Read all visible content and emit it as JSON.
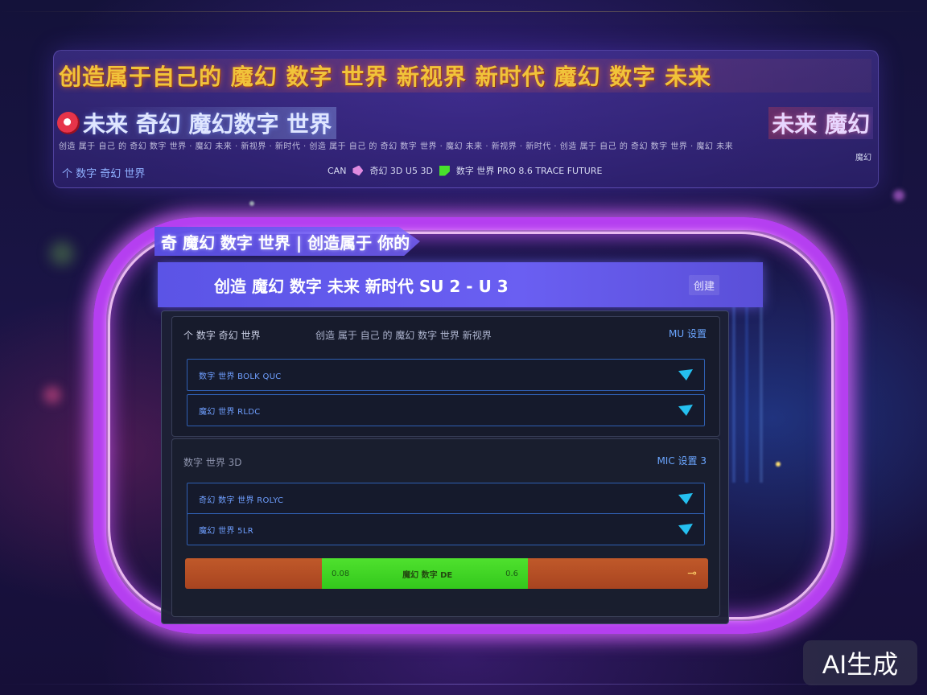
{
  "header": {
    "title": "创造属于自己的 魔幻 数字 世界 新视界 新时代 魔幻 数字 未来",
    "banner_left": "未来 奇幻 魔幻数字 世界",
    "banner_right": "未来 魔幻",
    "fine_print": "创造 属于 自己 的 奇幻 数字 世界 · 魔幻 未来 · 新视界 · 新时代 · 创造 属于 自己 的 奇幻 数字 世界 · 魔幻 未来 · 新视界 · 新时代 · 创造 属于 自己 的 奇幻 数字 世界 · 魔幻 未来",
    "subtitle": "个 数字 奇幻 世界",
    "status_prefix": "CAN",
    "status_a": "奇幻 3D U5 3D",
    "status_b": "数字 世界 PRO 8.6 TRACE FUTURE",
    "corner_glyph": "魔幻"
  },
  "window": {
    "strip_title": "奇 魔幻 数字 世界 | 创造属于 你的",
    "title": "创造 魔幻 数字 未来 新时代 SU 2 - U 3",
    "title_action": "创建"
  },
  "section1": {
    "label": "个 数字 奇幻 世界",
    "note": "创造 属于 自己 的 魔幻 数字 世界 新视界",
    "link": "MU 设置",
    "select_1": "数字 世界 BOLK QUC",
    "select_2": "魔幻 世界 RLDC"
  },
  "section2": {
    "label": "数字 世界 3D",
    "link": "MIC 设置 3",
    "select_1": "奇幻 数字 世界 ROLYC",
    "select_2": "魔幻 世界 5LR"
  },
  "action_bar": {
    "mid_left": "0.08",
    "mid_center": "魔幻 数字 DE",
    "mid_right": "0.6",
    "arrow": "⊸"
  },
  "watermark": "AI生成",
  "colors": {
    "portal": "#b53ff0",
    "title_gold": "#f1c33a",
    "strip": "#5b54e6",
    "accent_blue": "#25c0f0",
    "bar_orange": "#c0592a",
    "bar_green": "#4fe12e"
  }
}
